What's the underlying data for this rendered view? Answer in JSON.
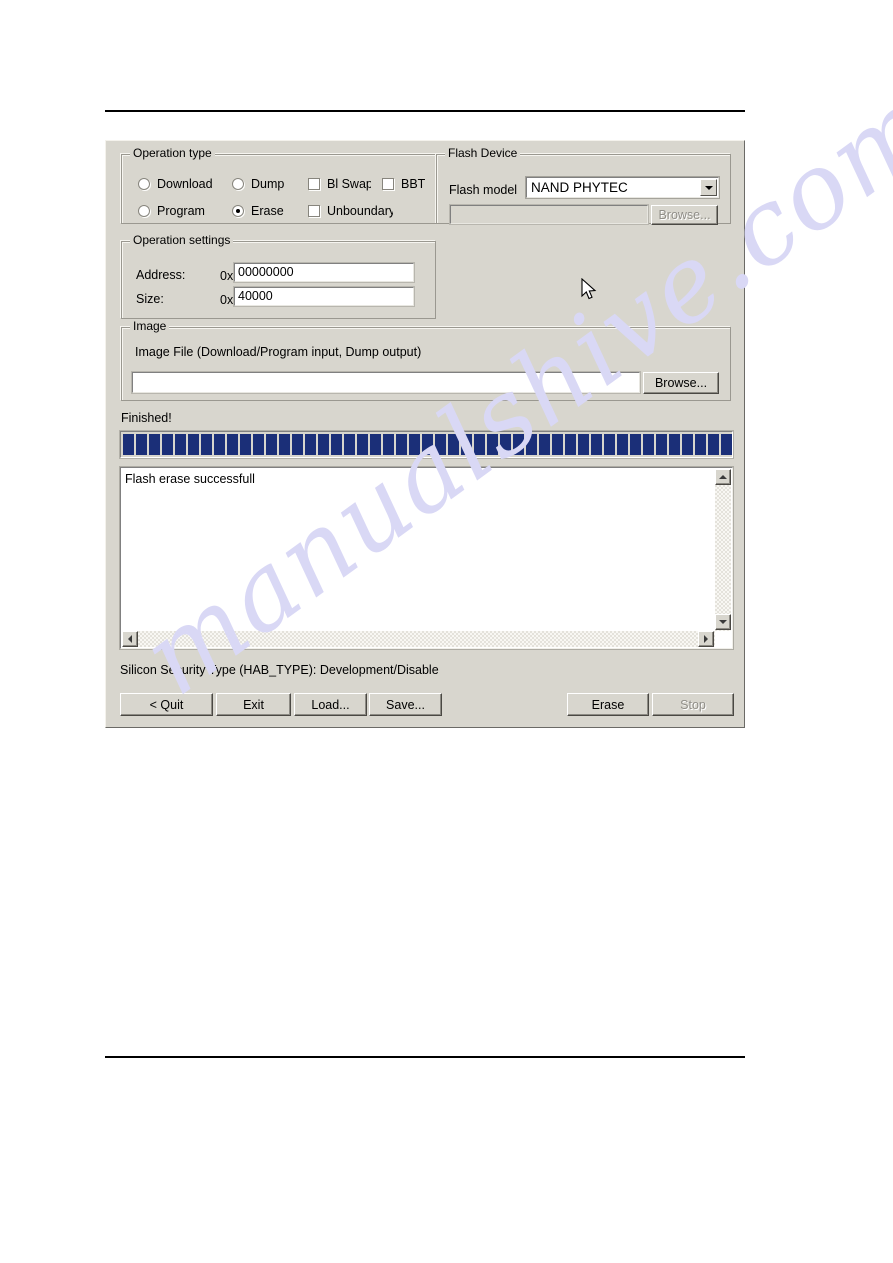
{
  "document": {
    "watermark": "manualshive.com"
  },
  "dialog": {
    "operation_type": {
      "title": "Operation type",
      "radios": [
        {
          "label": "Download",
          "checked": false
        },
        {
          "label": "Dump",
          "checked": false
        },
        {
          "label": "Program",
          "checked": false
        },
        {
          "label": "Erase",
          "checked": true
        }
      ],
      "checkboxes": [
        {
          "label": "Bl Swap",
          "checked": false
        },
        {
          "label": "BBT",
          "checked": false
        },
        {
          "label": "Unboundary",
          "checked": false
        }
      ]
    },
    "flash_device": {
      "title": "Flash Device",
      "model_label": "Flash model",
      "model_value": "NAND PHYTEC",
      "model_options": [
        "NAND PHYTEC"
      ],
      "path_value": "",
      "browse_label": "Browse...",
      "browse_enabled": false
    },
    "operation_settings": {
      "title": "Operation settings",
      "address_label": "Address:",
      "address_prefix": "0x",
      "address_value": "00000000",
      "size_label": "Size:",
      "size_prefix": "0x",
      "size_value": "40000"
    },
    "image": {
      "title": "Image",
      "description": "Image File (Download/Program input, Dump output)",
      "file_value": "",
      "browse_label": "Browse..."
    },
    "status": {
      "label": "Finished!",
      "progress_percent": 100,
      "progress_segments": 48,
      "progress_color": "#1b2f78"
    },
    "log": {
      "lines": [
        "Flash erase successfull"
      ]
    },
    "security": {
      "text": "Silicon Security Type (HAB_TYPE):  Development/Disable"
    },
    "buttons": {
      "quit": {
        "label": "< Quit",
        "enabled": true
      },
      "exit": {
        "label": "Exit",
        "enabled": true
      },
      "load": {
        "label": "Load...",
        "enabled": true
      },
      "save": {
        "label": "Save...",
        "enabled": true
      },
      "erase": {
        "label": "Erase",
        "enabled": true
      },
      "stop": {
        "label": "Stop",
        "enabled": false
      }
    }
  }
}
